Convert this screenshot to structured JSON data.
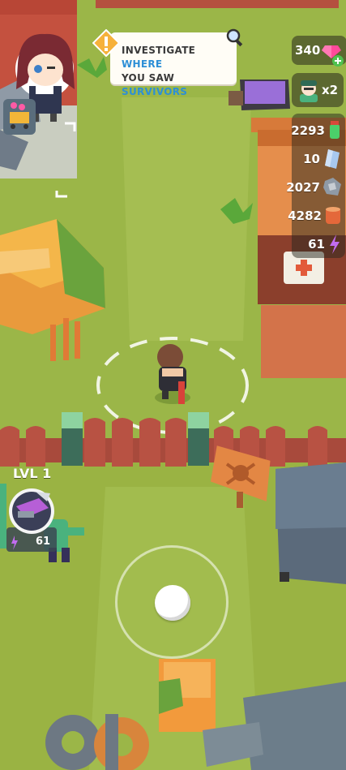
{
  "quest": {
    "text_pre": "INVESTIGATE ",
    "text_hl1": "WHERE",
    "text_mid": "YOU SAW ",
    "text_hl2": "SURVIVORS",
    "icon": "exclamation-icon"
  },
  "currency": {
    "gems": "340",
    "gem_icon": "pink-gem-icon",
    "plus_icon": "plus-icon"
  },
  "survivors": {
    "multiplier": "x2",
    "icon": "survivor-avatar-icon"
  },
  "resources": [
    {
      "value": "2293",
      "icon": "green-jar-icon"
    },
    {
      "value": "10",
      "icon": "blue-crystal-icon"
    },
    {
      "value": "2027",
      "icon": "metal-scrap-icon"
    },
    {
      "value": "4282",
      "icon": "wood-log-icon"
    },
    {
      "value": "61",
      "icon": "lightning-icon"
    }
  ],
  "player_hud": {
    "level": "LVL 1",
    "energy": "61",
    "ability_icon": "drill-icon"
  },
  "colors": {
    "grass": "#9bb648",
    "accent_blue": "#2d8fd6",
    "fence": "#a84a3c"
  }
}
